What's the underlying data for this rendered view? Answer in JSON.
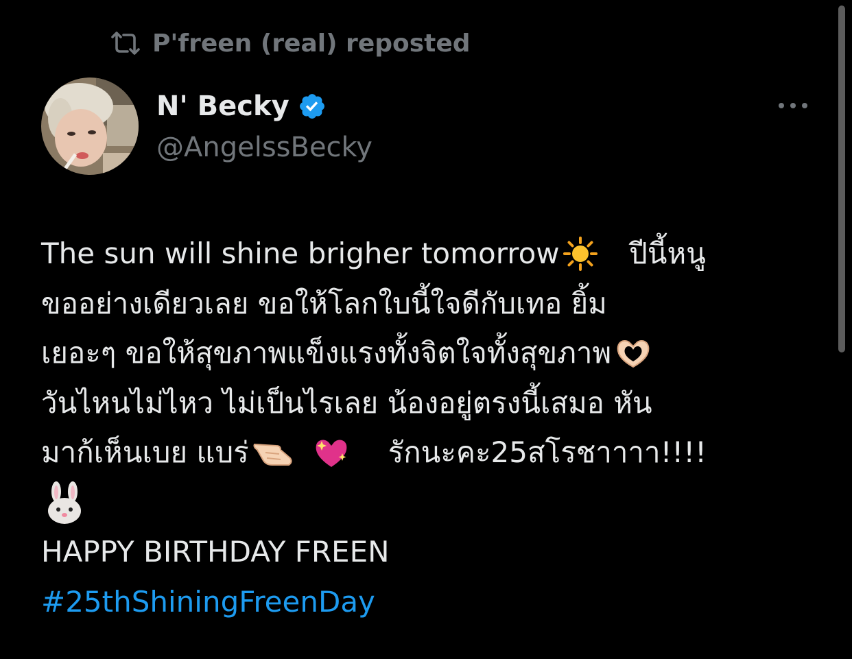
{
  "repost": {
    "text": "P'freen (real) reposted",
    "icon": "repost-icon"
  },
  "author": {
    "display_name": "N' Becky",
    "handle": "@AngelssBecky",
    "verified_icon": "verified-badge-icon",
    "verified_color": "#1d9bf0"
  },
  "more_icon": "more-options-icon",
  "tweet": {
    "line1_text": "The sun will shine brigher tomorrow",
    "line1_emoji": "sun-icon",
    "line1_thai": " ปีนี้หนู",
    "line2": "ขออย่างเดียวเลย ขอให้โลกใบนี้ใจดีกับเทอ ยิ้ม",
    "line3_text": "เยอะๆ ขอให้สุขภาพแข็งแรงทั้งจิตใจทั้งสุขภาพ",
    "line3_emoji": "heart-hands-icon",
    "line4": "วันไหนไม่ไหว ไม่เป็นไรเลย น้องอยู่ตรงนี้เสมอ หัน",
    "line5_text": "มาก้เห็นเบย แบร่",
    "line5_emoji1": "pointing-hand-icon",
    "line5_emoji2": "sparkling-heart-icon",
    "line5_tail": "  รักนะคะ25สโรชาาาา!!!!",
    "line6_emoji": "rabbit-face-icon",
    "line7": "HAPPY BIRTHDAY FREEN",
    "hashtag": "#25thShiningFreenDay"
  },
  "colors": {
    "background": "#000000",
    "primary_text": "#e7e9ea",
    "secondary_text": "#71767b",
    "link": "#1d9bf0"
  }
}
